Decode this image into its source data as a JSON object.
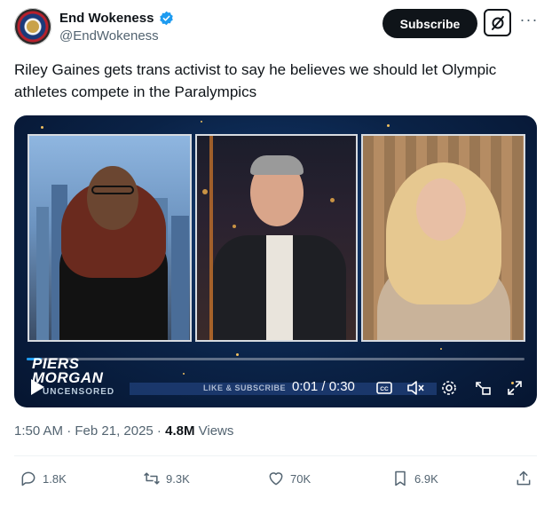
{
  "author": {
    "name": "End Wokeness",
    "handle": "@EndWokeness"
  },
  "header": {
    "subscribe_label": "Subscribe"
  },
  "post": {
    "text": "Riley Gaines gets trans activist to say he believes we should let Olympic athletes compete in the Paralympics"
  },
  "video": {
    "logo_line1": "PIERS",
    "logo_line2": "MORGAN",
    "logo_line3": "UNCENSORED",
    "ticker": "LIKE & SUBSCRIBE",
    "time": "0:01 / 0:30",
    "progress": 0.03
  },
  "meta": {
    "timestamp": "1:50 AM · Feb 21, 2025 · ",
    "views_count": "4.8M",
    "views_label": " Views"
  },
  "actions": {
    "replies": "1.8K",
    "reposts": "9.3K",
    "likes": "70K",
    "bookmarks": "6.9K"
  },
  "colors": {
    "accent": "#1d9bf0",
    "text": "#0f1419",
    "muted": "#536471"
  }
}
